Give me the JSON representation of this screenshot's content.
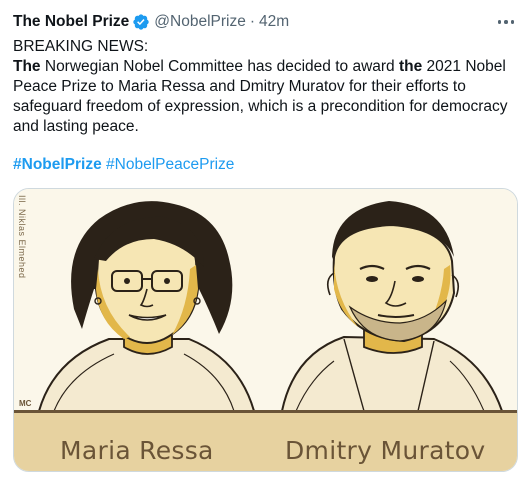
{
  "tweet": {
    "author_name": "The Nobel Prize",
    "handle": "@NobelPrize",
    "separator": "·",
    "time": "42m",
    "headline": "BREAKING NEWS:",
    "body_1": "The",
    "body_2": " Norwegian Nobel Committee has decided to award ",
    "body_3": "the",
    "body_4": " 2021 Nobel Peace Prize to Maria Ressa and Dmitry Muratov for their efforts to safeguard freedom of expression, which is a precondition for democracy and lasting peace.",
    "hashtag_1": "#NobelPrize",
    "hashtag_2": "#NobelPeacePrize"
  },
  "media": {
    "signature": "Ill. Niklas Elmehed",
    "corner_mark": "MC",
    "name_left": "Maria Ressa",
    "name_right": "Dmitry Muratov"
  },
  "colors": {
    "accent": "#1d9bf0",
    "gold": "#e2b74a",
    "caption_band": "#e7d2a0",
    "ink": "#2b2218"
  }
}
